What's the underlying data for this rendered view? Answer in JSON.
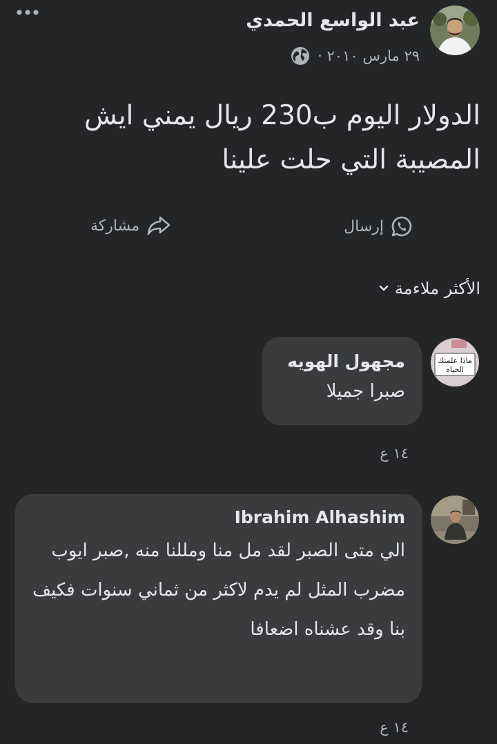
{
  "post": {
    "author": "عبد الواسع الحمدي",
    "date": "٢٩ مارس ٢٠١٠ ·",
    "privacy_icon": "globe-icon",
    "text": "الدولار اليوم ب230 ريال يمني ايش المصيبة التي حلت علينا",
    "actions": {
      "send_label": "إرسال",
      "share_label": "مشاركة"
    }
  },
  "comments_sort": {
    "label": "الأكثر ملاءمة"
  },
  "comments": [
    {
      "author": "مجهول الهويه",
      "avatar_text": "ماذا علمتك الحياه",
      "text": "صبرا جميلا",
      "time": "١٤ ع"
    },
    {
      "author": "Ibrahim Alhashim",
      "text": "الي متى الصبر لقد مل منا ومللنا منه ,صبر ايوب مضرب المثل لم يدم لاكثر من ثماني سنوات فكيف بنا وقد عشناه اضعافا",
      "time": "١٤ ع"
    }
  ],
  "colors": {
    "background": "#242526",
    "bubble": "#3a3b3c",
    "primary_text": "#e4e6eb",
    "secondary_text": "#b0b3b8"
  }
}
